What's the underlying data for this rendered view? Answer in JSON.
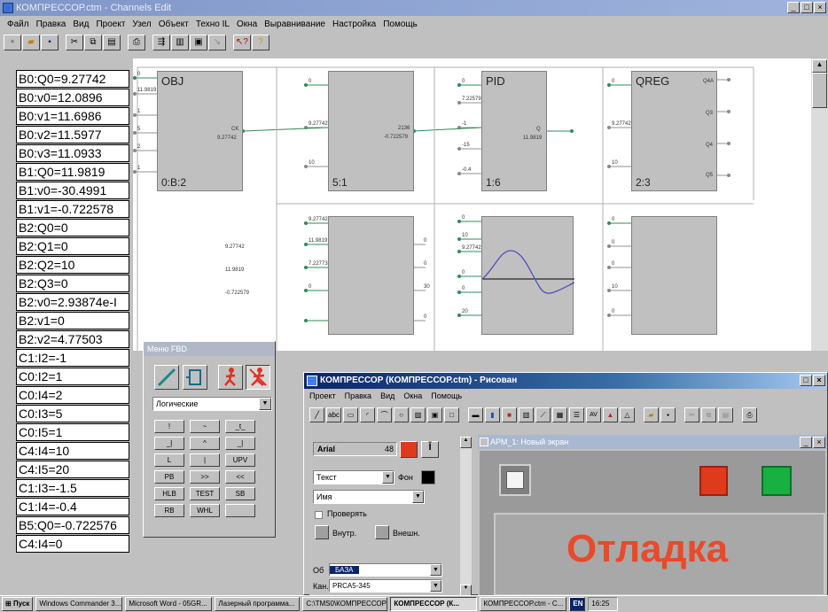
{
  "app": {
    "title": "КОМПРЕССОР.ctm - Channels Edit"
  },
  "menu": [
    "Файл",
    "Правка",
    "Вид",
    "Проект",
    "Узел",
    "Объект",
    "Техно IL",
    "Окна",
    "Выравнивание",
    "Настройка",
    "Помощь"
  ],
  "toolbar_icons": [
    "new-icon",
    "open-icon",
    "save-icon",
    "cut-icon",
    "copy-icon",
    "paste-icon",
    "print-icon",
    "tool-a-icon",
    "tool-b-icon",
    "tool-c-icon",
    "tool-d-icon",
    "help-icon",
    "question-icon"
  ],
  "variables": [
    "B0:Q0=9.27742",
    "B0:v0=12.0896",
    "B0:v1=11.6986",
    "B0:v2=11.5977",
    "B0:v3=11.0933",
    "B1:Q0=11.9819",
    "B1:v0=-30.4991",
    "B1:v1=-0.722578",
    "B2:Q0=0",
    "B2:Q1=0",
    "B2:Q2=10",
    "B2:Q3=0",
    "B2:v0=2.93874e-I",
    "B2:v1=0",
    "B2:v2=4.77503",
    "C1:I2=-1",
    "C0:I2=1",
    "C0:I4=2",
    "C0:I3=5",
    "C0:I5=1",
    "C4:I4=10",
    "C4:I5=20",
    "C1:I3=-1.5",
    "C1:I4=-0.4",
    "B5:Q0=-0.722576",
    "C4:I4=0"
  ],
  "blocks": {
    "obj": {
      "name": "OBJ",
      "id": "0:B:2",
      "out_label": "CK",
      "out_value": "9.27742"
    },
    "b51": {
      "id": "5:1",
      "out_value": "2136",
      "out_value2": "-0.722579"
    },
    "pid": {
      "name": "PID",
      "id": "1:6",
      "out_label": "Q",
      "out_value": "11.9819"
    },
    "qreg": {
      "name": "QREG",
      "id": "2:3",
      "outputs": [
        "Q4A",
        "Q3",
        "Q4",
        "Q5"
      ]
    }
  },
  "wire_values": {
    "obj_inputs": [
      "0",
      "11.9819",
      "1",
      "5",
      "2",
      "1"
    ],
    "b51_inputs": [
      "0",
      "9.27742",
      "10"
    ],
    "pid_inputs": [
      "0",
      "7.22579",
      "-1",
      "-15",
      "-0.4"
    ],
    "qreg_inputs": [
      "0",
      "9.27742",
      "10"
    ],
    "row2_left": [
      "9.27742",
      "11.9819",
      "-0.722579"
    ],
    "row2_b2_inputs": [
      "9.27742",
      "11.9819",
      "7.22773",
      "0"
    ],
    "row2_b2_outputs": [
      "0",
      "0",
      "30",
      "0"
    ],
    "row2_b3_inputs": [
      "0",
      "10",
      "9.27742",
      "0",
      "0",
      "20"
    ],
    "row2_b4_inputs": [
      "0",
      "0",
      "0",
      "10",
      "0"
    ]
  },
  "fbd_panel": {
    "title": "Меню FBD",
    "select": "Логические",
    "keys": [
      "!",
      "~",
      "_t_",
      "_|",
      "^",
      "_|",
      "L",
      "|",
      "UPV",
      "PB",
      ">>",
      "<<",
      "HLB",
      "TEST",
      "SB",
      "RB",
      "WHL",
      ""
    ]
  },
  "risovan": {
    "title": "КОМПРЕССОР (КОМПРЕССОР.ctm) - Рисован",
    "menu": [
      "Проект",
      "Правка",
      "Вид",
      "Окна",
      "Помощь"
    ],
    "props": {
      "font": "Arial",
      "font_size": "48",
      "type": "Текст",
      "fon_label": "Фон",
      "name_field": "Имя",
      "check_label": "Проверять",
      "inner_label": "Внутр.",
      "outer_label": "Внешн.",
      "db_label": "Об",
      "db_value": "БАЗА",
      "chan_label": "Кан.",
      "chan_value": "PRCA5-345"
    },
    "screen": {
      "title": "АРМ_1: Новый экран",
      "big_text": "Отладка"
    }
  },
  "taskbar": {
    "start": "Пуск",
    "tasks": [
      "Windows Commander 3...",
      "Microsoft Word - 05GR...",
      "Лазерный программа...",
      "C:\\TMS0\\КОМПРЕССОР\\...",
      "КОМПРЕССОР (К...",
      "КОМПРЕССОР.ctm - C..."
    ],
    "lang": "EN",
    "clock": "16:25"
  },
  "colors": {
    "title_inactive": "#8aa0d0",
    "title_active": "#0a246a",
    "wire": "#2e8b57",
    "red_btn": "#e03a1c",
    "green_btn": "#18b040",
    "debug_text": "#e84a2a"
  }
}
